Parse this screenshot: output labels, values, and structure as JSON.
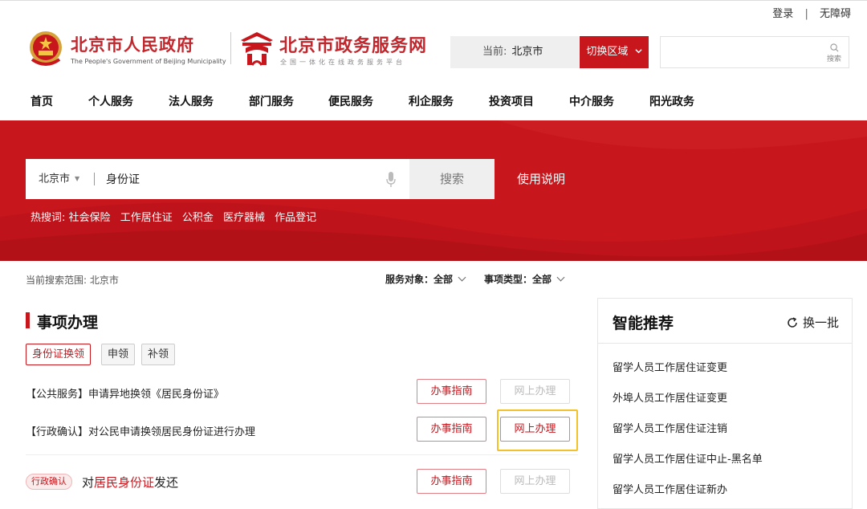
{
  "util": {
    "login": "登录",
    "separator": "|",
    "accessibility": "无障碍"
  },
  "header": {
    "gov_title": "北京市人民政府",
    "gov_subtitle": "The People's Government of Beijing Municipality",
    "portal_title": "北京市政务服务网",
    "portal_subtitle": "全国一体化在线政务服务平台",
    "region_prefix": "当前:",
    "region_value": "北京市",
    "switch_label": "切换区域",
    "top_search_placeholder": "",
    "top_search_label": "搜索"
  },
  "nav": [
    "首页",
    "个人服务",
    "法人服务",
    "部门服务",
    "便民服务",
    "利企服务",
    "投资项目",
    "中介服务",
    "阳光政务"
  ],
  "banner": {
    "scope": "北京市",
    "query": "身份证",
    "search_button": "搜索",
    "help_link": "使用说明",
    "hot_label": "热搜词:",
    "hot_words": [
      "社会保险",
      "工作居住证",
      "公积金",
      "医疗器械",
      "作品登记"
    ]
  },
  "filters": {
    "scope_text": "当前搜索范围: 北京市",
    "service_target": "服务对象：全部",
    "item_type": "事项类型：全部"
  },
  "section": {
    "title": "事项办理",
    "tags": [
      "身份证换领",
      "申领",
      "补领"
    ],
    "items": [
      {
        "text": "【公共服务】申请异地换领《居民身份证》",
        "guide": "办事指南",
        "online": "网上办理",
        "online_enabled": false
      },
      {
        "text": "【行政确认】对公民申请换领居民身份证进行办理",
        "guide": "办事指南",
        "online": "网上办理",
        "online_enabled": true
      }
    ],
    "third": {
      "badge": "行政确认",
      "prefix": "对",
      "highlight": "居民身份证",
      "suffix": "发还",
      "guide": "办事指南",
      "online": "网上办理"
    }
  },
  "recommend": {
    "title": "智能推荐",
    "refresh": "换一批",
    "items": [
      "留学人员工作居住证变更",
      "外埠人员工作居住证变更",
      "留学人员工作居住证注销",
      "留学人员工作居住证中止-黑名单",
      "留学人员工作居住证新办"
    ]
  },
  "colors": {
    "brand_red": "#c8161d",
    "highlight_border": "#f3c12b"
  }
}
